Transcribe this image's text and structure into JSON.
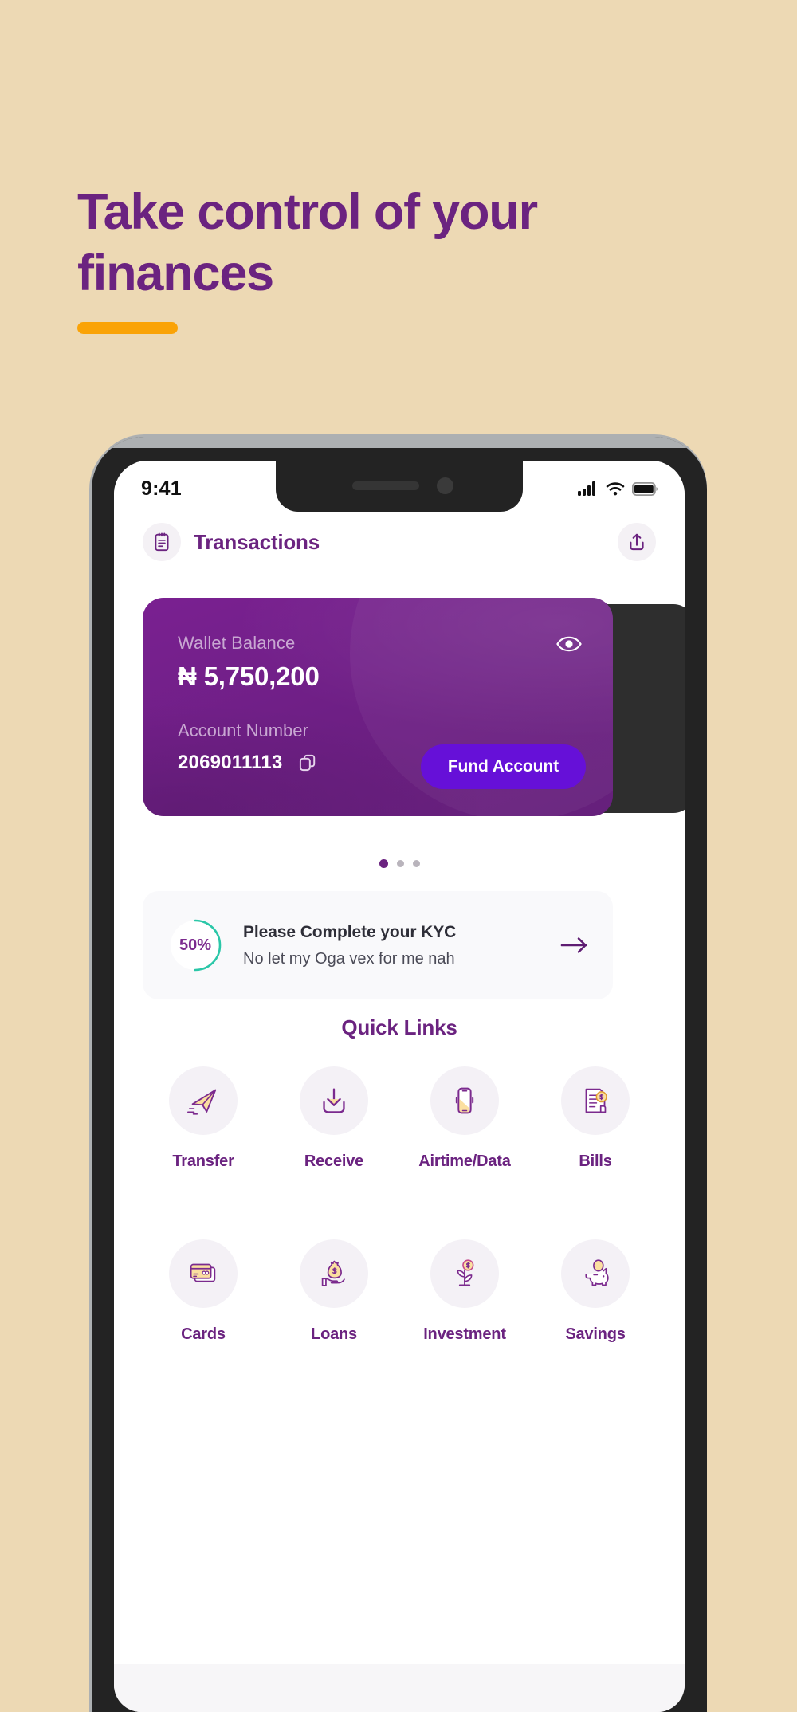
{
  "page": {
    "background_color": "#EDD9B4",
    "accent_purple": "#6B2380",
    "accent_orange": "#FAA307",
    "hero_title": "Take control of your finances"
  },
  "phone": {
    "status_bar": {
      "time": "9:41",
      "icons": [
        "signal-icon",
        "wifi-icon",
        "battery-icon"
      ]
    },
    "header": {
      "icon": "clipboard-icon",
      "title": "Transactions",
      "action_icon": "share-upload-icon"
    },
    "wallet_card": {
      "balance_label": "Wallet Balance",
      "balance_value": "₦ 5,750,200",
      "account_label": "Account Number",
      "account_number": "2069011113",
      "copy_icon": "copy-icon",
      "visibility_icon": "eye-icon",
      "fund_button": "Fund Account",
      "fund_button_color": "#6610D8",
      "card_color": "#6E1F85"
    },
    "carousel": {
      "total_dots": 3,
      "active_index": 0
    },
    "kyc": {
      "progress_percent": "50%",
      "progress_value": 50,
      "ring_color": "#2BC7A8",
      "title": "Please Complete your KYC",
      "subtitle": "No let my Oga vex for me nah",
      "arrow_icon": "arrow-right-icon"
    },
    "quick_links": {
      "title": "Quick Links",
      "items": [
        {
          "label": "Transfer",
          "icon": "paper-plane-icon"
        },
        {
          "label": "Receive",
          "icon": "download-tray-icon"
        },
        {
          "label": "Airtime/Data",
          "icon": "mobile-phone-icon"
        },
        {
          "label": "Bills",
          "icon": "invoice-dollar-icon"
        },
        {
          "label": "Cards",
          "icon": "credit-card-icon"
        },
        {
          "label": "Loans",
          "icon": "money-bag-hand-icon"
        },
        {
          "label": "Investment",
          "icon": "plant-coin-icon"
        },
        {
          "label": "Savings",
          "icon": "piggy-bank-icon"
        }
      ]
    }
  }
}
